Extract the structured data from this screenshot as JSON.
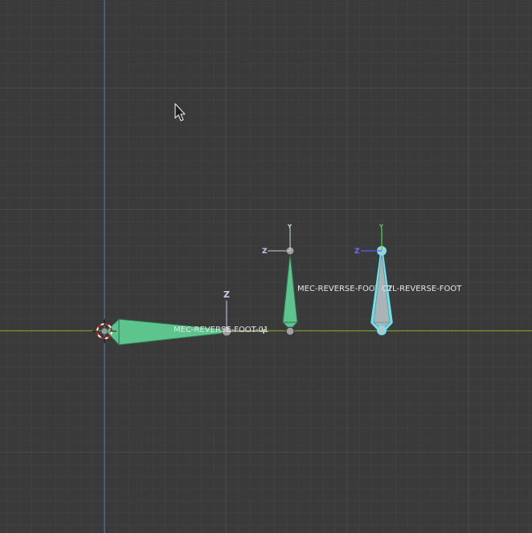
{
  "viewport": {
    "background_color": "#3a3a3a",
    "grid_minor_color": "#404040",
    "grid_major_color": "#4a4a4a",
    "x_axis_color": "#7a9a2a",
    "z_axis_color": "#4a78a0"
  },
  "bones": [
    {
      "name": "MEC-REVERSE-FOOT-01",
      "color": "#5ec48e",
      "selected": false
    },
    {
      "name": "MEC-REVERSE-FOOT-02",
      "color": "#5ec48e",
      "selected": false
    },
    {
      "name": "CTL-REVERSE-FOOT",
      "color": "#a8b4b8",
      "selected": true,
      "outline_color": "#66e6f0"
    }
  ],
  "axis_gizmos": {
    "bone1_up": "Z",
    "bone1_side": "Y",
    "bone2_up": "Y",
    "bone2_side": "Z",
    "bone3_up": "Y",
    "bone3_side": "Z"
  },
  "icons": [
    "3d-cursor-icon",
    "mouse-pointer-icon"
  ]
}
